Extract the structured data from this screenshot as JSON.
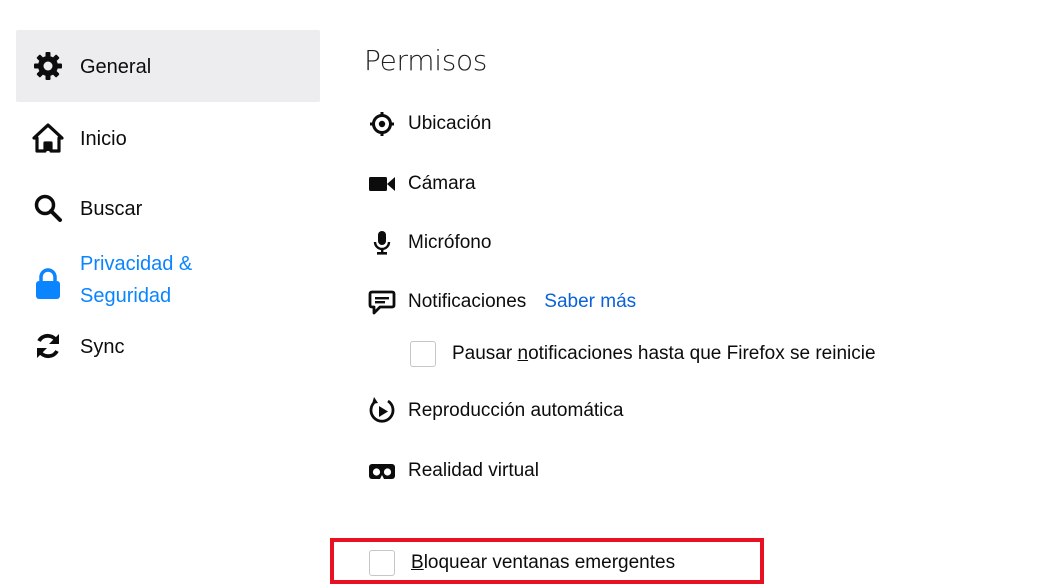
{
  "sidebar": {
    "items": [
      {
        "label": "General",
        "icon": "gear-icon"
      },
      {
        "label": "Inicio",
        "icon": "home-icon"
      },
      {
        "label": "Buscar",
        "icon": "search-icon"
      },
      {
        "label_line1": "Privacidad &",
        "label_line2": "Seguridad",
        "icon": "lock-icon",
        "selected": true
      },
      {
        "label": "Sync",
        "icon": "sync-icon"
      }
    ]
  },
  "permissions": {
    "title": "Permisos",
    "location": "Ubicación",
    "camera": "Cámara",
    "microphone": "Micrófono",
    "notifications": "Notificaciones",
    "learn_more": "Saber más",
    "pause_prefix": "Pausar ",
    "pause_underlined": "n",
    "pause_suffix": "otificaciones hasta que Firefox se reinicie",
    "autoplay": "Reproducción automática",
    "vr": "Realidad virtual",
    "block_popups_underlined": "B",
    "block_popups_rest": "loquear ventanas emergentes"
  },
  "colors": {
    "accent": "#0a84ff",
    "link": "#0a62d8",
    "selected_bg": "#ededf0",
    "highlight": "#e81123"
  }
}
